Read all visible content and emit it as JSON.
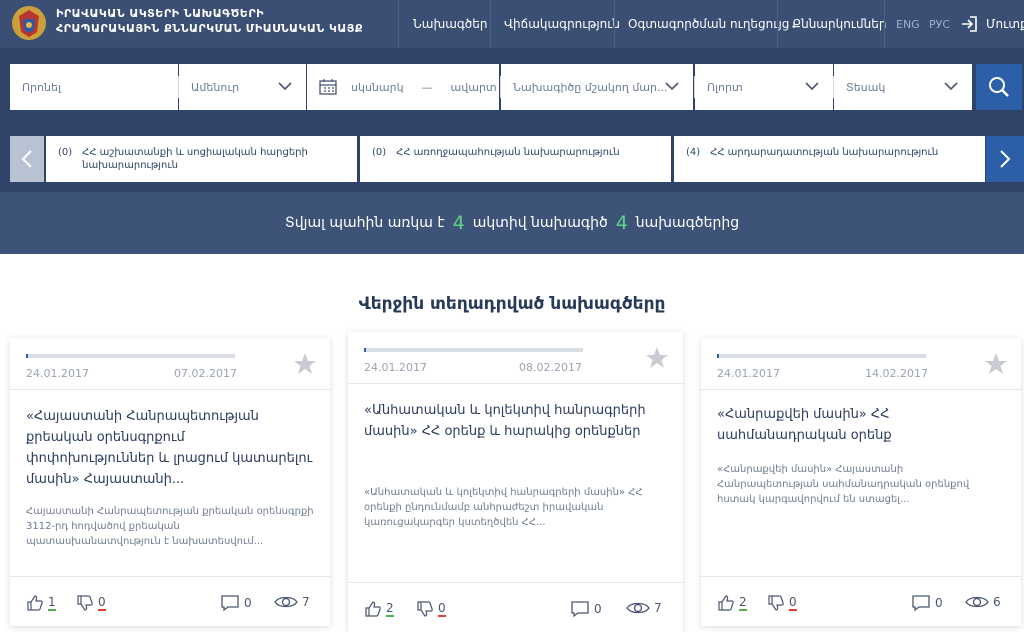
{
  "header": {
    "title_line1": "ԻՐԱՎԱԿԱՆ ԱԿՏԵՐԻ ՆԱԽԱԳԾԵՐԻ",
    "title_line2": "ՀՐԱՊԱՐԱԿԱՅԻՆ ՔՆՆԱՐԿՄԱՆ ՄԻԱՍՆԱԿԱՆ ԿԱՅՔ",
    "nav": [
      "Նախագծեր",
      "Վիճակագրություն",
      "Օգտագործման ուղեցույց",
      "Քննարկումներ"
    ],
    "lang_en": "ENG",
    "lang_ru": "РУС",
    "login": "Մուտք"
  },
  "filters": {
    "search_placeholder": "Որոնել",
    "all": "Ամենուր",
    "date_start": "սկսնարկ",
    "date_sep": "—",
    "date_end": "ավարտ",
    "developer": "Նախագիծը մշակող մար...",
    "sphere": "Ոլորտ",
    "type": "Տեսակ"
  },
  "ministries": [
    {
      "count": "(0)",
      "name": "ՀՀ աշխատանքի և սոցիալական հարցերի նախարարություն"
    },
    {
      "count": "(0)",
      "name": "ՀՀ առողջապահության նախարարություն"
    },
    {
      "count": "(4)",
      "name": "ՀՀ արդարադատության նախարարություն"
    }
  ],
  "status": {
    "prefix": "Տվյալ պահին առկա է",
    "active_count": "4",
    "middle": "ակտիվ նախագիծ",
    "total_count": "4",
    "suffix": "նախագծերից"
  },
  "section_title": "Վերջին տեղադրված նախագծերը",
  "cards": [
    {
      "start": "24.01.2017",
      "end": "07.02.2017",
      "progress": 0.01,
      "title": "«Հայաստանի Հանրապետության քրեական օրենսգրքում փոփոխություններ և լրացում կատարելու մասին» Հայաստանի...",
      "desc": "Հայաստանի Հանրապետության քրեական օրենսգրքի 3112-րդ հոդվածով քրեական պատասխանատվություն է նախատեսվում...",
      "likes": "1",
      "dislikes": "0",
      "comments": "0",
      "views": "7"
    },
    {
      "start": "24.01.2017",
      "end": "08.02.2017",
      "progress": 0.01,
      "title": "«Անհատական և կոլեկտիվ հանրագրերի մասին» ՀՀ օրենք և հարակից օրենքներ",
      "desc": "«Անհատական և կոլեկտիվ հանրագրերի մասին» ՀՀ օրենքի ընդունմամբ անհրաժեշտ իրավական կառուցակարգեր կստեղծվեն ՀՀ...",
      "likes": "2",
      "dislikes": "0",
      "comments": "0",
      "views": "7"
    },
    {
      "start": "24.01.2017",
      "end": "14.02.2017",
      "progress": 0.01,
      "title": "«Հանրաքվեի մասին» ՀՀ սահմանադրական օրենք",
      "desc": "«Հանրաքվեի մասին» Հայաստանի Հանրապետության սահմանադրական օրենքով  հստակ կարգավորվում են ստացել...",
      "likes": "2",
      "dislikes": "0",
      "comments": "0",
      "views": "6"
    }
  ]
}
